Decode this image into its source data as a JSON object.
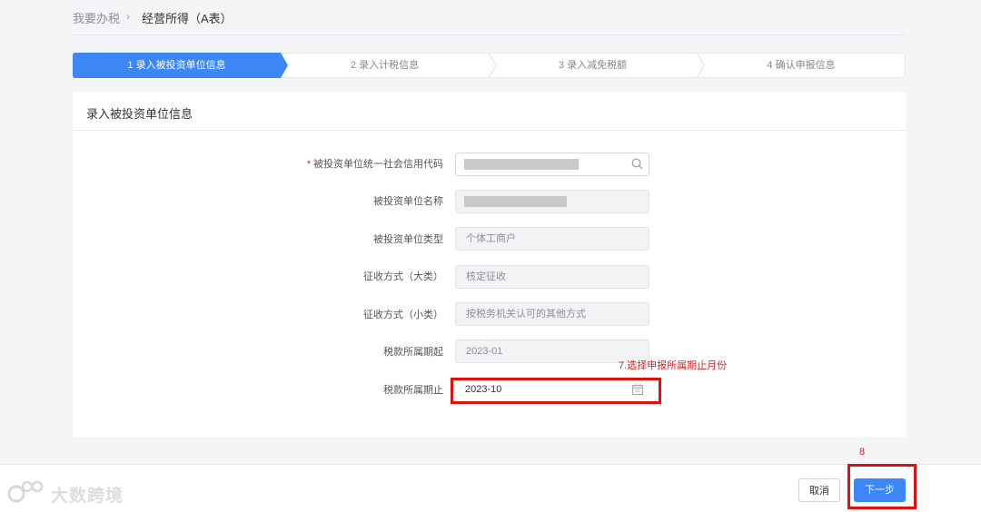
{
  "breadcrumb": {
    "home": "我要办税",
    "separator": "›",
    "current": "经营所得（A表）"
  },
  "steps": [
    {
      "label": "1  录入被投资单位信息",
      "active": true
    },
    {
      "label": "2  录入计税信息",
      "active": false
    },
    {
      "label": "3  录入减免税额",
      "active": false
    },
    {
      "label": "4  确认申报信息",
      "active": false
    }
  ],
  "colors": {
    "primary": "#3d86f5",
    "annotation": "#e02020",
    "frame": "#e01010"
  },
  "card": {
    "title": "录入被投资单位信息"
  },
  "form": {
    "credit_code": {
      "required_mark": "*",
      "label": "被投资单位统一社会信用代码",
      "value": ""
    },
    "name": {
      "label": "被投资单位名称",
      "value": ""
    },
    "type": {
      "label": "被投资单位类型",
      "value": "个体工商户"
    },
    "collect_major": {
      "label": "征收方式（大类）",
      "value": "核定征收"
    },
    "collect_minor": {
      "label": "征收方式（小类）",
      "value": "按税务机关认可的其他方式"
    },
    "period_start": {
      "label": "税款所属期起",
      "value": "2023-01"
    },
    "period_end": {
      "label": "税款所属期止",
      "value": "2023-10"
    }
  },
  "annotations": {
    "step7": "7.选择申报所属期止月份",
    "step8": "8"
  },
  "buttons": {
    "cancel": "取消",
    "next": "下一步"
  },
  "watermark": {
    "text": "大数跨境",
    "icon": "brand-logo-icon"
  }
}
